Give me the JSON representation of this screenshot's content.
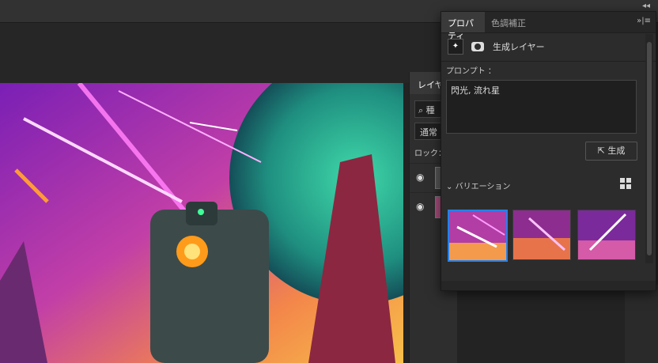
{
  "layers_panel": {
    "tab_label": "レイヤー",
    "search_value": "種",
    "blend_mode": "通常",
    "lock_label": "ロック："
  },
  "properties": {
    "tabs": [
      "プロパティ",
      "色調補正"
    ],
    "layer_type": "生成レイヤー",
    "prompt_label": "プロンプト ：",
    "prompt_value": "閃光, 流れ星",
    "generate_label": "生成",
    "variations_label": "バリエーション",
    "selected_variation": 1
  },
  "icons": {
    "generate": "generate-icon",
    "grid": "grid-view-icon",
    "eye": "eye-icon",
    "search": "search-icon"
  },
  "colors": {
    "accent": "#2680eb",
    "panel": "#2c2c2c"
  }
}
